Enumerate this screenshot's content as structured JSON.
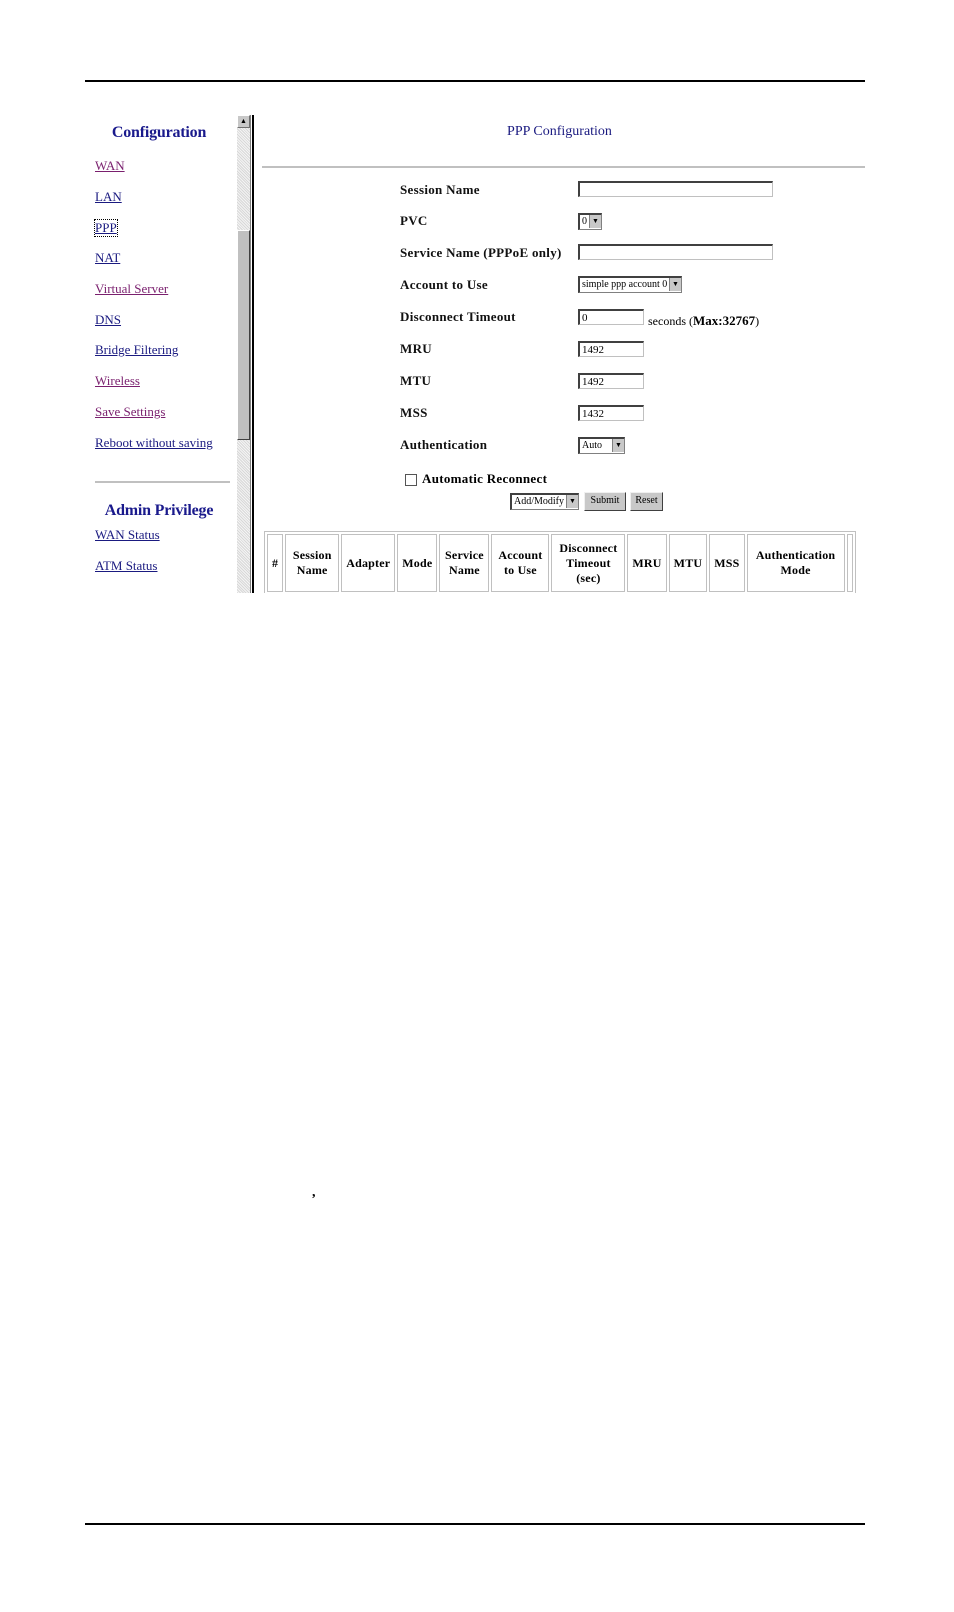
{
  "sidebar": {
    "configuration_heading": "Configuration",
    "config_links": [
      {
        "label": "WAN",
        "state": "visited"
      },
      {
        "label": "LAN",
        "state": "unvisited"
      },
      {
        "label": "PPP",
        "state": "focused"
      },
      {
        "label": "NAT",
        "state": "unvisited"
      },
      {
        "label": "Virtual Server",
        "state": "visited"
      },
      {
        "label": "DNS",
        "state": "unvisited"
      },
      {
        "label": "Bridge Filtering",
        "state": "unvisited"
      },
      {
        "label": "Wireless",
        "state": "visited"
      },
      {
        "label": "Save Settings",
        "state": "visited"
      },
      {
        "label": "Reboot without saving",
        "state": "unvisited"
      }
    ],
    "admin_heading": "Admin Privilege",
    "admin_links": [
      {
        "label": "WAN Status"
      },
      {
        "label": "ATM Status"
      }
    ]
  },
  "scrollbar": {
    "up_icon": "▲"
  },
  "main": {
    "title": "PPP Configuration",
    "form": {
      "session_name": {
        "label": "Session Name",
        "value": ""
      },
      "pvc": {
        "label": "PVC",
        "value": "0"
      },
      "service_name": {
        "label": "Service Name (PPPoE only)",
        "value": ""
      },
      "account": {
        "label": "Account to Use",
        "value": "simple ppp account 0"
      },
      "disconnect_timeout": {
        "label": "Disconnect Timeout",
        "value": "0",
        "suffix": "seconds (",
        "max": "Max:32767",
        "suffix_end": ")"
      },
      "mru": {
        "label": "MRU",
        "value": "1492"
      },
      "mtu": {
        "label": "MTU",
        "value": "1492"
      },
      "mss": {
        "label": "MSS",
        "value": "1432"
      },
      "authentication": {
        "label": "Authentication",
        "value": "Auto"
      },
      "auto_reconnect": {
        "label": "Automatic Reconnect",
        "checked": false
      }
    },
    "actions": {
      "mode_select": "Add/Modify",
      "submit": "Submit",
      "reset": "Reset"
    },
    "table": {
      "headers": [
        "#",
        "Session Name",
        "Adapter",
        "Mode",
        "Service Name",
        "Account to Use",
        "Disconnect Timeout (sec)",
        "MRU",
        "MTU",
        "MSS",
        "Authentication Mode"
      ]
    }
  },
  "page": {
    "stray_mark": ","
  }
}
